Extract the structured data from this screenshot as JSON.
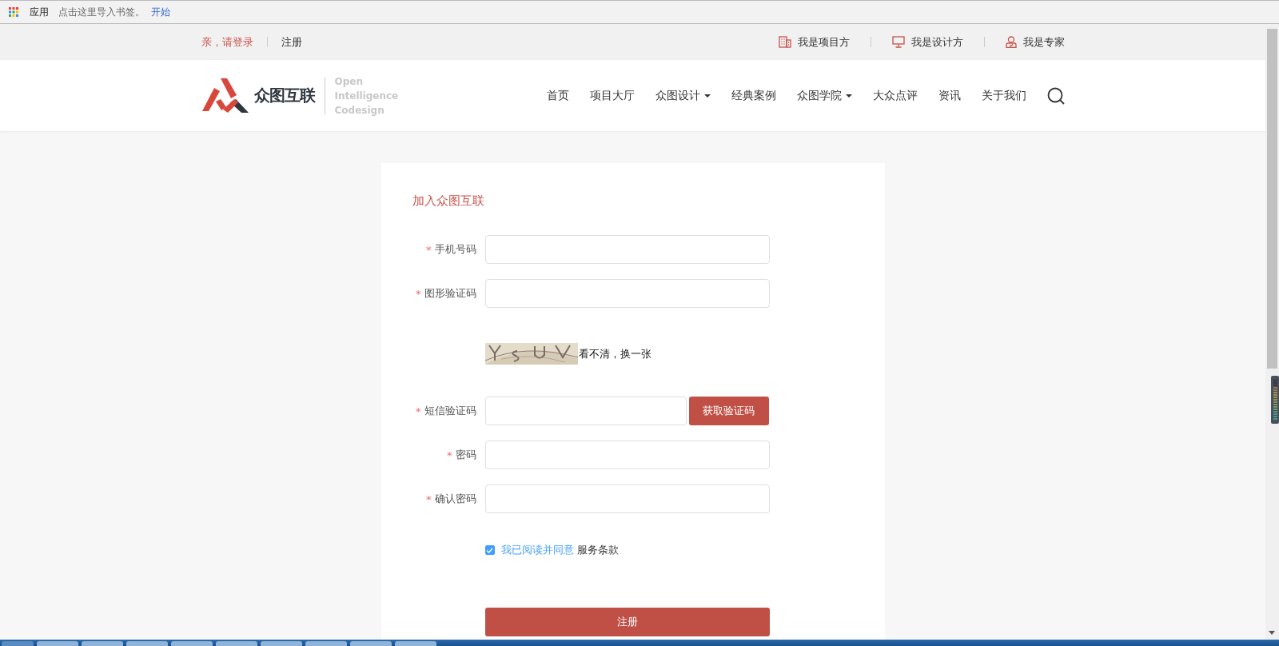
{
  "bookmarks_bar": {
    "apps_label": "应用",
    "hint": "点击这里导入书签。",
    "link": "开始"
  },
  "top_bar": {
    "login": "亲，请登录",
    "register": "注册",
    "roles": [
      "我是项目方",
      "我是设计方",
      "我是专家"
    ]
  },
  "header": {
    "logo_name": "众图互联",
    "tagline": [
      "Open",
      "Intelligence",
      "Codesign"
    ],
    "menu": [
      {
        "label": "首页",
        "dropdown": false
      },
      {
        "label": "项目大厅",
        "dropdown": false
      },
      {
        "label": "众图设计",
        "dropdown": true
      },
      {
        "label": "经典案例",
        "dropdown": false
      },
      {
        "label": "众图学院",
        "dropdown": true
      },
      {
        "label": "大众点评",
        "dropdown": false
      },
      {
        "label": "资讯",
        "dropdown": false
      },
      {
        "label": "关于我们",
        "dropdown": false
      }
    ]
  },
  "form": {
    "title": "加入众图互联",
    "rows": [
      {
        "kind": "input",
        "mark": "*",
        "label": "手机号码"
      },
      {
        "kind": "input",
        "mark": "*",
        "label": "图形验证码"
      },
      {
        "kind": "captcha",
        "refresh": "看不清，换一张"
      },
      {
        "kind": "sms",
        "mark": "*",
        "label": "短信验证码",
        "button": "获取验证码"
      },
      {
        "kind": "input",
        "mark": "*",
        "label": "密码"
      },
      {
        "kind": "input",
        "mark": "*",
        "label": "确认密码"
      }
    ],
    "agreement": {
      "checked": true,
      "link": "我已阅读并同意",
      "text": "服务条款"
    },
    "submit": "注册"
  }
}
